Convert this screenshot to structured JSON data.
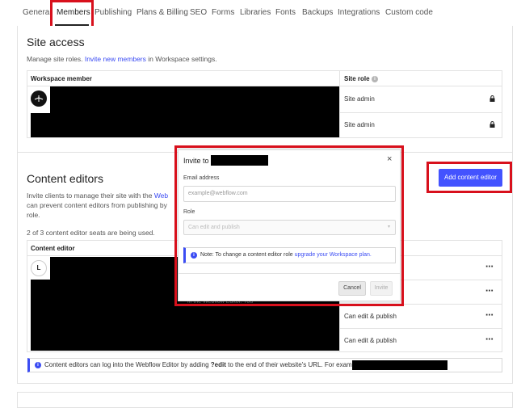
{
  "tabs": [
    {
      "label": "General"
    },
    {
      "label": "Members"
    },
    {
      "label": "Publishing"
    },
    {
      "label": "Plans & Billing"
    },
    {
      "label": "SEO"
    },
    {
      "label": "Forms"
    },
    {
      "label": "Libraries"
    },
    {
      "label": "Fonts"
    },
    {
      "label": "Backups"
    },
    {
      "label": "Integrations"
    },
    {
      "label": "Custom code"
    }
  ],
  "active_tab": "Members",
  "site_access": {
    "title": "Site access",
    "description_prefix": "Manage site roles. ",
    "description_link": "Invite new members",
    "description_suffix": " in Workspace settings.",
    "col_member": "Workspace member",
    "col_role": "Site role",
    "rows": [
      {
        "role": "Site admin"
      },
      {
        "role": "Site admin"
      }
    ]
  },
  "content_editors": {
    "title": "Content editors",
    "description_prefix": "Invite clients to manage their site with the ",
    "description_link": "Web",
    "description_line2": "can prevent content editors from publishing by",
    "description_line3": "role.",
    "seats_text": "2 of 3 content editor seats are being used.",
    "col_editor": "Content editor",
    "avatar_letter": "L",
    "partial_text": "in the Webflow Editor. You",
    "rows": [
      {
        "role": ""
      },
      {
        "role": ""
      },
      {
        "role": "Can edit & publish"
      },
      {
        "role": "Can edit & publish"
      }
    ],
    "add_button": "Add content editor",
    "info_text_prefix": "Content editors can log into the Webflow Editor by adding ",
    "info_text_bold": "?edit",
    "info_text_suffix": " to the end of their website's URL. For example: "
  },
  "modal": {
    "title_prefix": "Invite to ",
    "close_label": "×",
    "email_label": "Email address",
    "email_placeholder": "example@webflow.com",
    "role_label": "Role",
    "role_value": "Can edit and publish",
    "note_prefix": "Note: To change a content editor role ",
    "note_link": "upgrade your Workspace plan.",
    "cancel_label": "Cancel",
    "invite_label": "Invite"
  },
  "colors": {
    "accent": "#4353ff",
    "highlight": "#d8101c"
  }
}
